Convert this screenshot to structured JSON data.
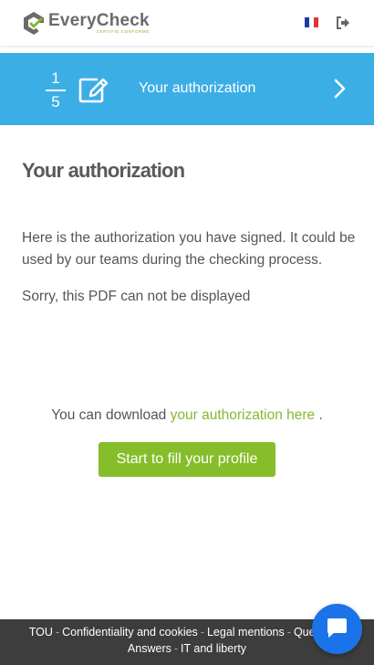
{
  "header": {
    "logo_word_1": "Every",
    "logo_word_2": "Check",
    "logo_tagline": "CERTIFIÉ CONFORME",
    "language_flag": "fr-flag-icon",
    "logout_icon": "sign-out-icon"
  },
  "banner": {
    "step_current": "1",
    "step_total": "5",
    "step_icon": "edit-icon",
    "title": "Your authorization",
    "next_icon": "chevron-right-icon"
  },
  "main": {
    "title": "Your authorization",
    "description": "Here is the authorization you have signed. It could be used by our teams during the checking process.",
    "pdf_message": "Sorry, this PDF can not be displayed",
    "download_prefix": "You can download",
    "download_link": "your authorization here",
    "download_suffix": ".",
    "cta_label": "Start to fill your profile"
  },
  "footer": {
    "links": [
      "TOU",
      "Confidentiality and cookies",
      "Legal mentions",
      "Questions",
      "Answers",
      "IT and liberty"
    ]
  },
  "chat": {
    "icon": "chat-icon"
  },
  "colors": {
    "banner": "#3caee6",
    "accent_green": "#86bd2a",
    "footer": "#3d3d3d",
    "chat": "#1a73e8"
  }
}
